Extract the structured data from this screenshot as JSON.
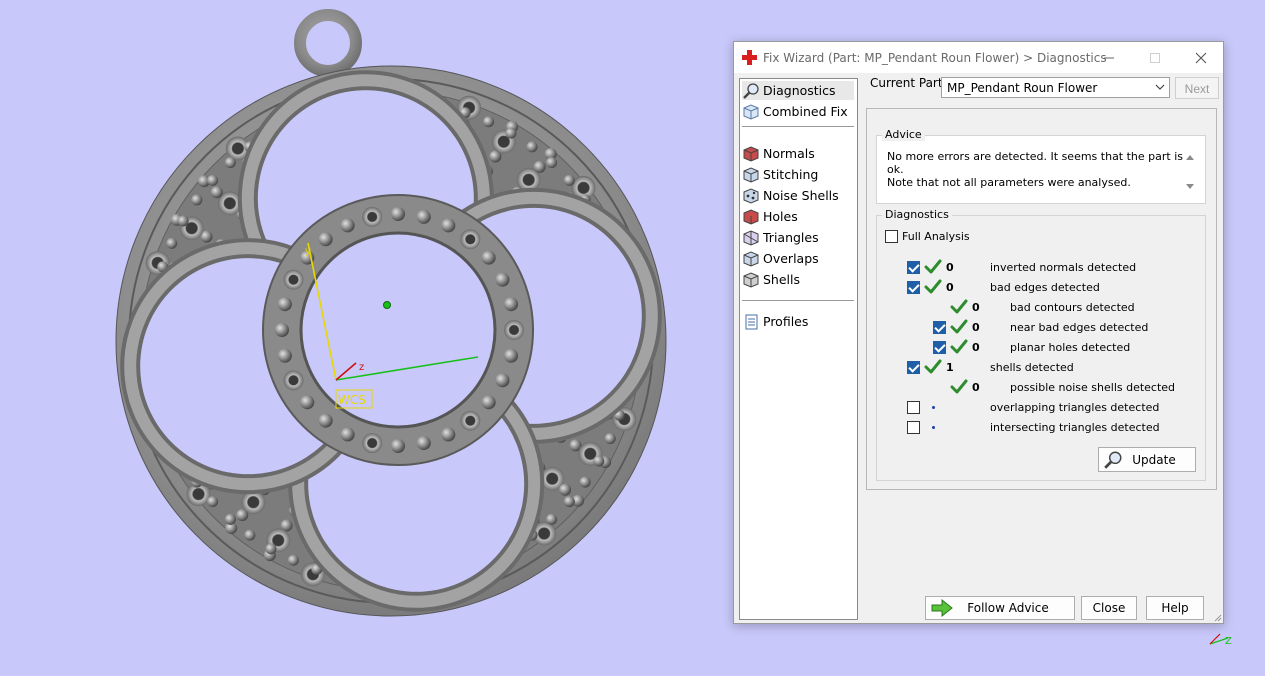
{
  "window": {
    "title": "Fix Wizard (Part: MP_Pendant Roun Flower) > Diagnostics",
    "minimize_icon": "minimize-icon",
    "maximize_icon": "maximize-icon",
    "close_icon": "close-icon"
  },
  "nav": {
    "items": [
      {
        "label": "Diagnostics",
        "icon": "magnifier-icon"
      },
      {
        "label": "Combined Fix",
        "icon": "cube-icon"
      },
      {
        "label": "Normals",
        "icon": "normals-icon"
      },
      {
        "label": "Stitching",
        "icon": "stitching-icon"
      },
      {
        "label": "Noise Shells",
        "icon": "noise-shells-icon"
      },
      {
        "label": "Holes",
        "icon": "holes-icon"
      },
      {
        "label": "Triangles",
        "icon": "triangles-icon"
      },
      {
        "label": "Overlaps",
        "icon": "overlaps-icon"
      },
      {
        "label": "Shells",
        "icon": "shells-icon"
      },
      {
        "label": "Profiles",
        "icon": "document-icon"
      }
    ]
  },
  "current_part": {
    "label": "Current Part:",
    "value": "MP_Pendant Roun Flower",
    "next_label": "Next"
  },
  "advice": {
    "title": "Advice",
    "line1": "No more errors are detected. It seems that the part is ok.",
    "line2": "Note that not all parameters were analysed."
  },
  "diagnostics": {
    "title": "Diagnostics",
    "full_analysis_label": "Full Analysis",
    "full_analysis_checked": false,
    "rows": [
      {
        "checkbox": true,
        "checked": true,
        "status": "ok",
        "count": "0",
        "label": "inverted normals detected",
        "indent": 0
      },
      {
        "checkbox": true,
        "checked": true,
        "status": "ok",
        "count": "0",
        "label": "bad edges detected",
        "indent": 0
      },
      {
        "checkbox": false,
        "checked": false,
        "status": "ok",
        "count": "0",
        "label": "bad contours detected",
        "indent": 1
      },
      {
        "checkbox": true,
        "checked": true,
        "status": "ok",
        "count": "0",
        "label": "near bad edges detected",
        "indent": 1
      },
      {
        "checkbox": true,
        "checked": true,
        "status": "ok",
        "count": "0",
        "label": "planar holes detected",
        "indent": 1
      },
      {
        "checkbox": true,
        "checked": true,
        "status": "ok",
        "count": "1",
        "label": "shells detected",
        "indent": 0
      },
      {
        "checkbox": false,
        "checked": false,
        "status": "ok",
        "count": "0",
        "label": "possible noise shells detected",
        "indent": 1
      },
      {
        "checkbox": true,
        "checked": false,
        "status": "none",
        "count": "",
        "label": "overlapping triangles detected",
        "indent": 0
      },
      {
        "checkbox": true,
        "checked": false,
        "status": "none",
        "count": "",
        "label": "intersecting triangles detected",
        "indent": 0
      }
    ],
    "update_label": "Update"
  },
  "footer": {
    "follow_advice_label": "Follow Advice",
    "close_label": "Close",
    "help_label": "Help"
  },
  "viewport": {
    "axis_z_label": "z",
    "wcs_label": "WCS",
    "corner_axis_label": "Z"
  },
  "colors": {
    "background": "#c8c8fa",
    "model_gray": "#8e8e8e",
    "checkbox_blue": "#1f5fa8",
    "tick_green": "#2e8b2e",
    "axis_y": "#e8d800",
    "axis_x": "#19c019",
    "axis_z": "#d01010"
  }
}
